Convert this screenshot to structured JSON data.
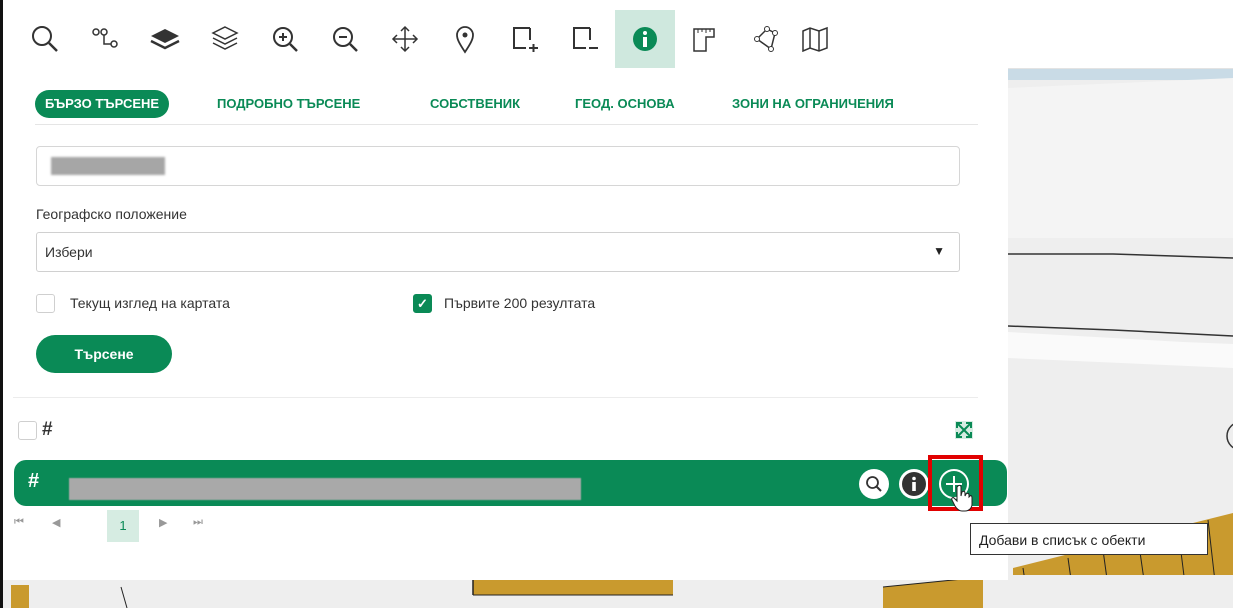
{
  "toolbar": {
    "tools": [
      {
        "name": "search-icon"
      },
      {
        "name": "route-icon"
      },
      {
        "name": "layers-filled-icon"
      },
      {
        "name": "layers-outline-icon"
      },
      {
        "name": "zoom-in-icon"
      },
      {
        "name": "zoom-out-icon"
      },
      {
        "name": "pan-icon"
      },
      {
        "name": "location-pin-icon"
      },
      {
        "name": "add-rectangle-icon"
      },
      {
        "name": "remove-rectangle-icon"
      },
      {
        "name": "info-icon",
        "active": true
      },
      {
        "name": "measure-icon"
      },
      {
        "name": "polygon-icon"
      },
      {
        "name": "map-icon"
      }
    ]
  },
  "tabs": [
    "БЪРЗО ТЪРСЕНЕ",
    "ПОДРОБНО ТЪРСЕНЕ",
    "СОБСТВЕНИК",
    "ГЕОД. ОСНОВА",
    "ЗОНИ НА ОГРАНИЧЕНИЯ"
  ],
  "search": {
    "value": ""
  },
  "geo": {
    "label": "Географско положение",
    "selected": "Избери"
  },
  "options": {
    "current_view": {
      "label": "Текущ изглед на картата",
      "checked": false
    },
    "first_200": {
      "label": "Първите 200 резултата",
      "checked": true
    }
  },
  "search_button": "Търсене",
  "results": {
    "row_text": ""
  },
  "pager": {
    "first": "⏮",
    "prev": "◀",
    "page": "1",
    "next": "▶",
    "last": "⏭"
  },
  "tooltip": "Добави в списък с обекти",
  "colors": {
    "accent": "#0a8a56",
    "highlight": "#e10000",
    "parcel": "#c99a2e"
  }
}
